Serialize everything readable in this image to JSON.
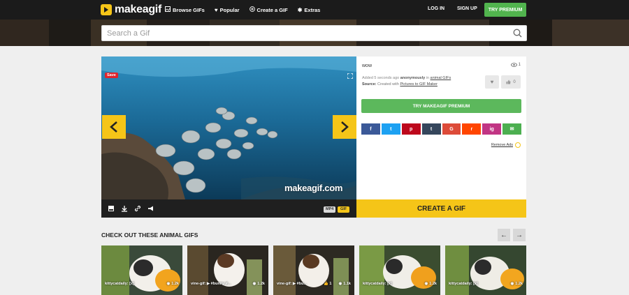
{
  "nav": {
    "logo_text": "makeagif",
    "items": [
      {
        "label": "Browse GIFs",
        "icon": "image-icon"
      },
      {
        "label": "Popular",
        "icon": "heart-icon"
      },
      {
        "label": "Create a GIF",
        "icon": "plus-circle-icon"
      },
      {
        "label": "Extras",
        "icon": "gear-icon"
      }
    ],
    "login": "LOG IN",
    "signup": "SIGN UP",
    "premium": "TRY PREMIUM"
  },
  "search": {
    "placeholder": "Search a Gif"
  },
  "player": {
    "save_label": "Save",
    "watermark": "makeagif.com",
    "format_mp4": "MP4",
    "format_gif": "GIF"
  },
  "info": {
    "title": "wow",
    "views": "1",
    "added_prefix": "Added 5 seconds ago",
    "added_by": "anonymously",
    "added_in": "in",
    "category_link": "animal GIFs",
    "source_label": "Source:",
    "source_text": "Created with",
    "source_link": "Pictures to GIF Maker",
    "like_count": "0",
    "try_premium": "TRY MAKEAGIF PREMIUM",
    "share": [
      {
        "label": "f",
        "name": "facebook",
        "color": "#3b5998"
      },
      {
        "label": "t",
        "name": "twitter",
        "color": "#1da1f2"
      },
      {
        "label": "p",
        "name": "pinterest",
        "color": "#bd081c"
      },
      {
        "label": "t",
        "name": "tumblr",
        "color": "#35465c"
      },
      {
        "label": "G",
        "name": "google",
        "color": "#dd4b39"
      },
      {
        "label": "r",
        "name": "reddit",
        "color": "#ff4500"
      },
      {
        "label": "ig",
        "name": "instagram",
        "color": "#c13584"
      },
      {
        "label": "✉",
        "name": "email",
        "color": "#4caf50"
      }
    ],
    "remove_ads": "Remove Ads"
  },
  "create_gif": "CREATE A GIF",
  "related": {
    "title": "CHECK OUT THESE ANIMAL GIFS",
    "cards": [
      {
        "label": "kittycatdaily: [x]",
        "views": "1.2k",
        "like": ""
      },
      {
        "label": "vine-gif: ▶ #bunny #...",
        "views": "1.2k",
        "like": ""
      },
      {
        "label": "vine-gif: ▶ #bu...",
        "views": "1.1k",
        "like": "👍 1"
      },
      {
        "label": "kittycatdaily: [x]",
        "views": "1.2k",
        "like": ""
      },
      {
        "label": "kittycatdaily: [x]",
        "views": "1.2k",
        "like": ""
      }
    ]
  },
  "colors": {
    "accent": "#f5c518",
    "premium_green": "#51b44e",
    "nav_bg": "#1b1b1b"
  }
}
